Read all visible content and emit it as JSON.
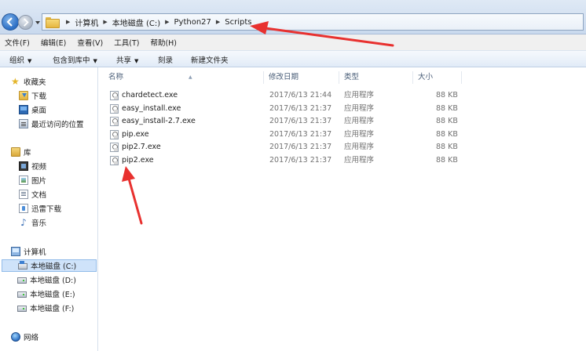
{
  "address": {
    "crumbs": [
      "计算机",
      "本地磁盘 (C:)",
      "Python27",
      "Scripts"
    ]
  },
  "menu": [
    "文件(F)",
    "编辑(E)",
    "查看(V)",
    "工具(T)",
    "帮助(H)"
  ],
  "toolbar": {
    "organize": "组织",
    "include_in_library": "包含到库中",
    "share": "共享",
    "burn": "刻录",
    "new_folder": "新建文件夹"
  },
  "sidebar": {
    "favorites": {
      "header": "收藏夹",
      "items": [
        "下载",
        "桌面",
        "最近访问的位置"
      ]
    },
    "libraries": {
      "header": "库",
      "items": [
        "视频",
        "图片",
        "文档",
        "迅雷下载",
        "音乐"
      ]
    },
    "computer": {
      "header": "计算机",
      "items": [
        "本地磁盘 (C:)",
        "本地磁盘 (D:)",
        "本地磁盘 (E:)",
        "本地磁盘 (F:)"
      ],
      "selected": "本地磁盘 (C:)"
    },
    "network": {
      "header": "网络"
    }
  },
  "columns": {
    "name": "名称",
    "modified": "修改日期",
    "type": "类型",
    "size": "大小"
  },
  "files": [
    {
      "name": "chardetect.exe",
      "modified": "2017/6/13 21:44",
      "type": "应用程序",
      "size": "88 KB"
    },
    {
      "name": "easy_install.exe",
      "modified": "2017/6/13 21:37",
      "type": "应用程序",
      "size": "88 KB"
    },
    {
      "name": "easy_install-2.7.exe",
      "modified": "2017/6/13 21:37",
      "type": "应用程序",
      "size": "88 KB"
    },
    {
      "name": "pip.exe",
      "modified": "2017/6/13 21:37",
      "type": "应用程序",
      "size": "88 KB"
    },
    {
      "name": "pip2.7.exe",
      "modified": "2017/6/13 21:37",
      "type": "应用程序",
      "size": "88 KB"
    },
    {
      "name": "pip2.exe",
      "modified": "2017/6/13 21:37",
      "type": "应用程序",
      "size": "88 KB"
    }
  ],
  "colors": {
    "annotation_arrow": "#e8312f",
    "selection": "#cfe3fa"
  }
}
